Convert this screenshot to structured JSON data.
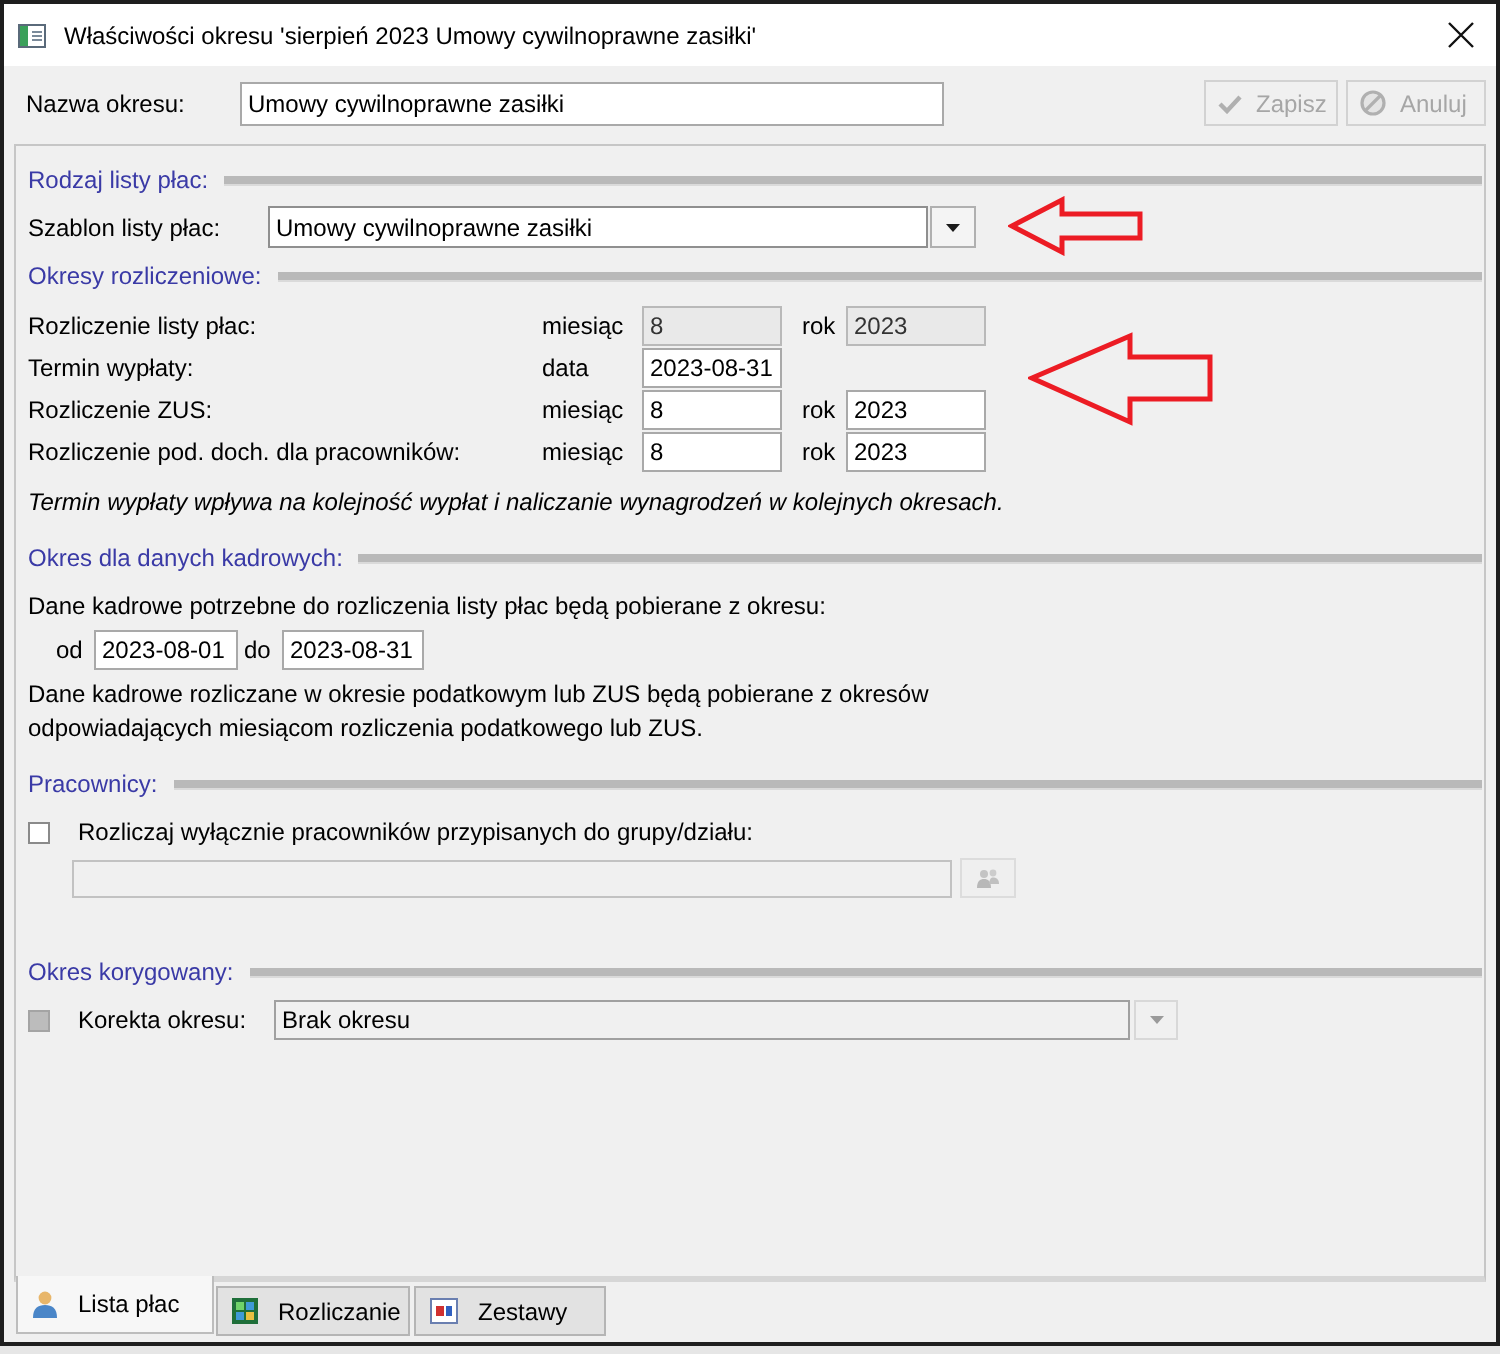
{
  "window": {
    "title": "Właściwości okresu 'sierpień 2023 Umowy cywilnoprawne zasiłki'"
  },
  "header": {
    "name_label": "Nazwa okresu:",
    "name_value": "Umowy cywilnoprawne zasiłki",
    "buttons": [
      {
        "label": "Zapisz",
        "disabled": true
      },
      {
        "label": "Anuluj",
        "disabled": true
      }
    ]
  },
  "payroll_type": {
    "heading": "Rodzaj listy płac:",
    "template_label": "Szablon listy płac:",
    "template": {
      "value": "Umowy cywilnoprawne zasiłki",
      "disabled": false
    }
  },
  "settlement_periods": {
    "heading": "Okresy rozliczeniowe:",
    "rows": [
      {
        "label": "Rozliczenie listy płac:",
        "fields": [
          {
            "label": "miesiąc",
            "value": "8",
            "disabled": true
          },
          {
            "label": "rok",
            "value": "2023",
            "disabled": true
          }
        ]
      },
      {
        "label": "Termin wypłaty:",
        "fields": [
          {
            "label": "data",
            "value": "2023-08-31",
            "disabled": false
          }
        ]
      },
      {
        "label": "Rozliczenie ZUS:",
        "fields": [
          {
            "label": "miesiąc",
            "value": "8",
            "disabled": false
          },
          {
            "label": "rok",
            "value": "2023",
            "disabled": false
          }
        ]
      },
      {
        "label": "Rozliczenie pod. doch. dla pracowników:",
        "fields": [
          {
            "label": "miesiąc",
            "value": "8",
            "disabled": false
          },
          {
            "label": "rok",
            "value": "2023",
            "disabled": false
          }
        ]
      }
    ],
    "note": "Termin wypłaty wpływa na kolejność wypłat i naliczanie wynagrodzeń w kolejnych okresach."
  },
  "hr_period": {
    "heading": "Okres dla danych kadrowych:",
    "intro": "Dane kadrowe potrzebne do rozliczenia listy płac będą pobierane z okresu:",
    "from_label": "od",
    "from_value": "2023-08-01",
    "to_label": "do",
    "to_value": "2023-08-31",
    "note": "Dane kadrowe rozliczane w okresie podatkowym lub ZUS będą pobierane z okresów odpowiadających miesiącom rozliczenia podatkowego lub ZUS."
  },
  "employees": {
    "heading": "Pracownicy:",
    "checkbox": {
      "label": "Rozliczaj wyłącznie pracowników przypisanych do grupy/działu:",
      "checked": false
    },
    "group_field": {
      "disabled": true
    }
  },
  "corrected_period": {
    "heading": "Okres korygowany:",
    "checkbox": {
      "label": "Korekta okresu:",
      "checked": false,
      "disabled": true
    },
    "period": {
      "value": "Brak okresu",
      "disabled": true
    }
  },
  "tabs": [
    {
      "label": "Lista płac",
      "selected": true
    },
    {
      "label": "Rozliczanie",
      "selected": false
    },
    {
      "label": "Zestawy",
      "selected": false
    }
  ]
}
